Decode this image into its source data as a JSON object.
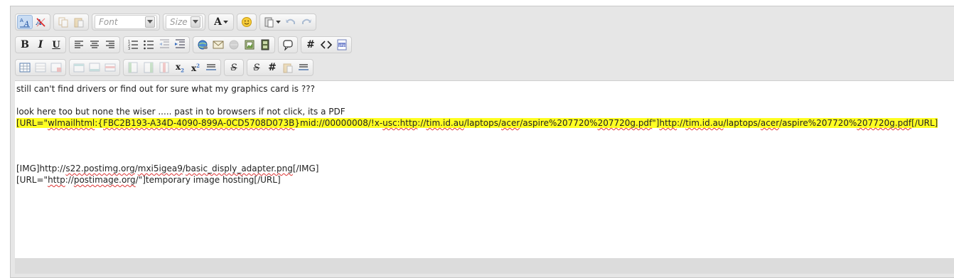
{
  "toolbar": {
    "font_placeholder": "Font",
    "size_placeholder": "Size",
    "color_glyph": "A"
  },
  "content": {
    "line1": "still can't find drivers or find out for sure what my graphics card is ???",
    "line2": "look here too but none the wiser ..... past in to browsers if not click, its a PDF",
    "url_line": [
      {
        "t": "[URL=\"",
        "sq": false
      },
      {
        "t": "wlmailhtml",
        "sq": true
      },
      {
        "t": ":{",
        "sq": false
      },
      {
        "t": "FBC2B193-A34D-4090-899A-0CD5708D073B",
        "sq": true
      },
      {
        "t": "}mid://00000008/!x-",
        "sq": false
      },
      {
        "t": "usc:http",
        "sq": true
      },
      {
        "t": "://",
        "sq": false
      },
      {
        "t": "tim.id.au",
        "sq": true
      },
      {
        "t": "/laptops/",
        "sq": false
      },
      {
        "t": "acer",
        "sq": true
      },
      {
        "t": "/aspire%207720%",
        "sq": false
      },
      {
        "t": "207720g.pdf",
        "sq": true
      },
      {
        "t": "\"]",
        "sq": false
      },
      {
        "t": "http",
        "sq": true
      },
      {
        "t": "://",
        "sq": false
      },
      {
        "t": "tim.id.au",
        "sq": true
      },
      {
        "t": "/laptops/",
        "sq": false
      },
      {
        "t": "acer",
        "sq": true
      },
      {
        "t": "/aspire%207720%",
        "sq": false
      },
      {
        "t": "207720g.pdf",
        "sq": true
      },
      {
        "t": "[/URL]",
        "sq": false
      }
    ],
    "img_line": [
      {
        "t": "[IMG]http://",
        "sq": false
      },
      {
        "t": "s22.postimg.org",
        "sq": true
      },
      {
        "t": "/",
        "sq": false
      },
      {
        "t": "mxi5igea9",
        "sq": true
      },
      {
        "t": "/",
        "sq": false
      },
      {
        "t": "basic_disply_adapter.png",
        "sq": true
      },
      {
        "t": "[/IMG]",
        "sq": false
      }
    ],
    "link_line": [
      {
        "t": "[URL=\"",
        "sq": false
      },
      {
        "t": "http",
        "sq": true
      },
      {
        "t": "://",
        "sq": false
      },
      {
        "t": "postimage.org",
        "sq": true
      },
      {
        "t": "/\"]temporary image hosting[/URL]",
        "sq": false
      }
    ]
  },
  "colors": {
    "highlight": "#ffff22",
    "toolbar_bg": "#e6e6e6",
    "active_button": "#c9dcf3"
  }
}
